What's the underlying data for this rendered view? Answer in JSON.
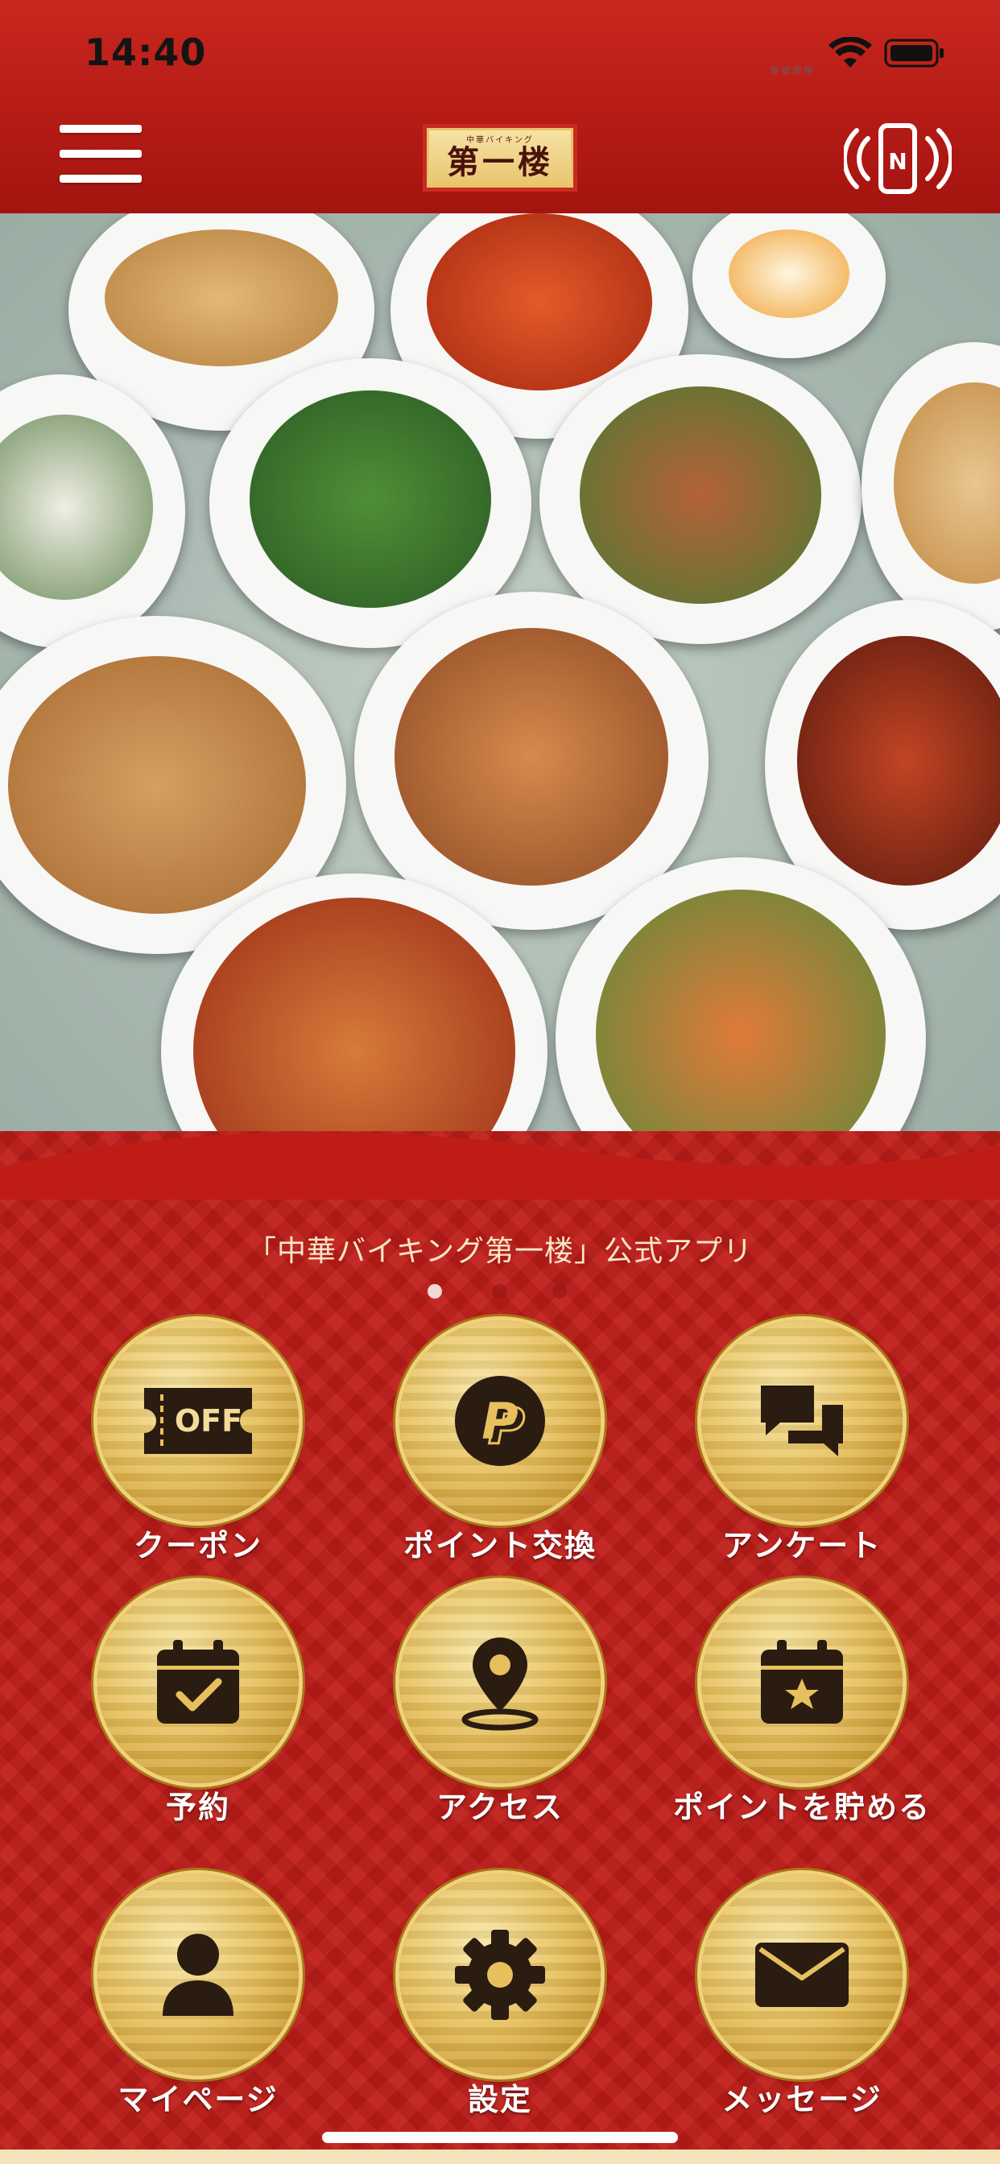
{
  "status_bar": {
    "time": "14:40"
  },
  "header": {
    "logo_small": "中華バイキング",
    "logo_text": "第一楼"
  },
  "app_title": "「中華バイキング第一楼」公式アプリ",
  "carousel": {
    "pages": 3,
    "active_index": 0
  },
  "tiles": [
    {
      "label": "クーポン",
      "icon": "coupon-off-icon"
    },
    {
      "label": "ポイント交換",
      "icon": "point-exchange-icon"
    },
    {
      "label": "アンケート",
      "icon": "chat-bubbles-icon"
    },
    {
      "label": "予約",
      "icon": "calendar-check-icon"
    },
    {
      "label": "アクセス",
      "icon": "map-pin-icon"
    },
    {
      "label": "ポイントを貯める",
      "icon": "calendar-star-icon"
    },
    {
      "label": "マイページ",
      "icon": "user-icon"
    },
    {
      "label": "設定",
      "icon": "gear-icon"
    },
    {
      "label": "メッセージ",
      "icon": "envelope-icon"
    }
  ],
  "coupon_icon_text": "OFF",
  "colors": {
    "header_red": "#b51b16",
    "gold": "#e7c05d",
    "icon_dark": "#2a1c10"
  }
}
